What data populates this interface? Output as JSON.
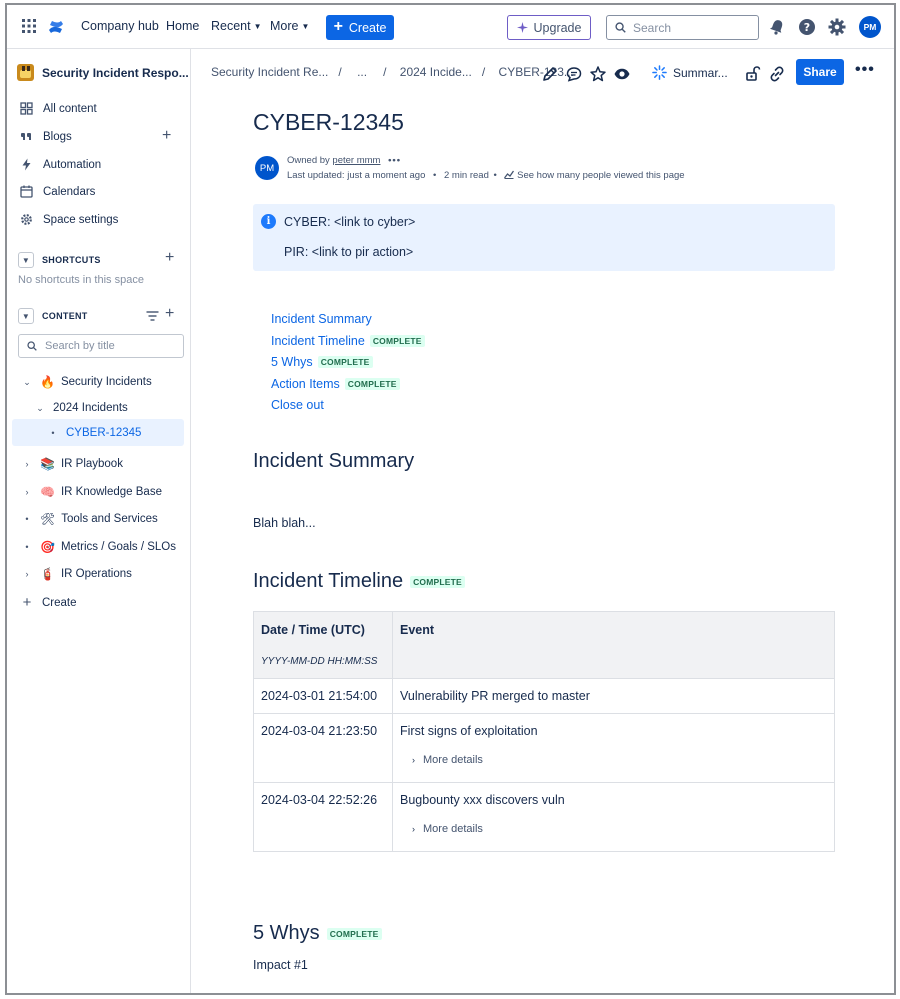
{
  "topnav": {
    "company_hub": "Company hub",
    "home": "Home",
    "recent": "Recent",
    "more": "More",
    "create": "Create",
    "upgrade": "Upgrade",
    "search_placeholder": "Search",
    "user_initials": "PM"
  },
  "sidebar": {
    "space_name": "Security Incident Respo...",
    "items": [
      {
        "label": "All content",
        "icon": "all-content-icon"
      },
      {
        "label": "Blogs",
        "icon": "quote-icon"
      },
      {
        "label": "Automation",
        "icon": "lightning-icon"
      },
      {
        "label": "Calendars",
        "icon": "calendar-icon"
      },
      {
        "label": "Space settings",
        "icon": "gear-icon"
      }
    ],
    "shortcuts_label": "SHORTCUTS",
    "no_shortcuts": "No shortcuts in this space",
    "content_label": "CONTENT",
    "search_placeholder": "Search by title",
    "tree": [
      {
        "label": "Security Incidents",
        "emoji": "🔥"
      },
      {
        "label": "2024 Incidents"
      },
      {
        "label": "CYBER-12345"
      },
      {
        "label": "IR Playbook",
        "emoji": "📚"
      },
      {
        "label": "IR Knowledge Base",
        "emoji": "🧠"
      },
      {
        "label": "Tools and Services",
        "emoji": "🛠"
      },
      {
        "label": "Metrics / Goals / SLOs",
        "emoji": "🎯"
      },
      {
        "label": "IR Operations",
        "emoji": "🧯"
      }
    ],
    "create": "Create"
  },
  "breadcrumb": {
    "items": [
      "Security Incident Re...",
      "...",
      "2024 Incide...",
      "CYBER-123..."
    ],
    "separator": "/",
    "summarize": "Summar...",
    "share": "Share"
  },
  "page": {
    "title": "CYBER-12345",
    "author_initials": "PM",
    "owned_by": "Owned by",
    "owner": "peter mmm",
    "last_updated": "Last updated: just a moment ago",
    "read_time": "2 min read",
    "views": "See how many people viewed this page",
    "panel": {
      "line1": "CYBER: <link to cyber>",
      "line2": "PIR: <link to pir action>"
    },
    "toc": [
      {
        "label": "Incident Summary",
        "status": ""
      },
      {
        "label": "Incident Timeline",
        "status": "COMPLETE"
      },
      {
        "label": "5 Whys",
        "status": "COMPLETE"
      },
      {
        "label": "Action Items",
        "status": "COMPLETE"
      },
      {
        "label": "Close out",
        "status": ""
      }
    ],
    "summary_heading": "Incident Summary",
    "summary_text": "Blah blah...",
    "timeline_heading": "Incident Timeline",
    "timeline_status": "COMPLETE",
    "timeline": {
      "headers": [
        "Date / Time (UTC)",
        "Event"
      ],
      "format_hint": "YYYY-MM-DD HH:MM:SS",
      "rows": [
        {
          "time": "2024-03-01 21:54:00",
          "event": "Vulnerability PR merged to master",
          "details": ""
        },
        {
          "time": "2024-03-04 21:23:50",
          "event": "First signs of exploitation",
          "details": "More details"
        },
        {
          "time": "2024-03-04 22:52:26",
          "event": "Bugbounty xxx discovers vuln",
          "details": "More details"
        }
      ]
    },
    "whys_heading": "5 Whys",
    "whys_status": "COMPLETE",
    "impact": "Impact #1"
  }
}
